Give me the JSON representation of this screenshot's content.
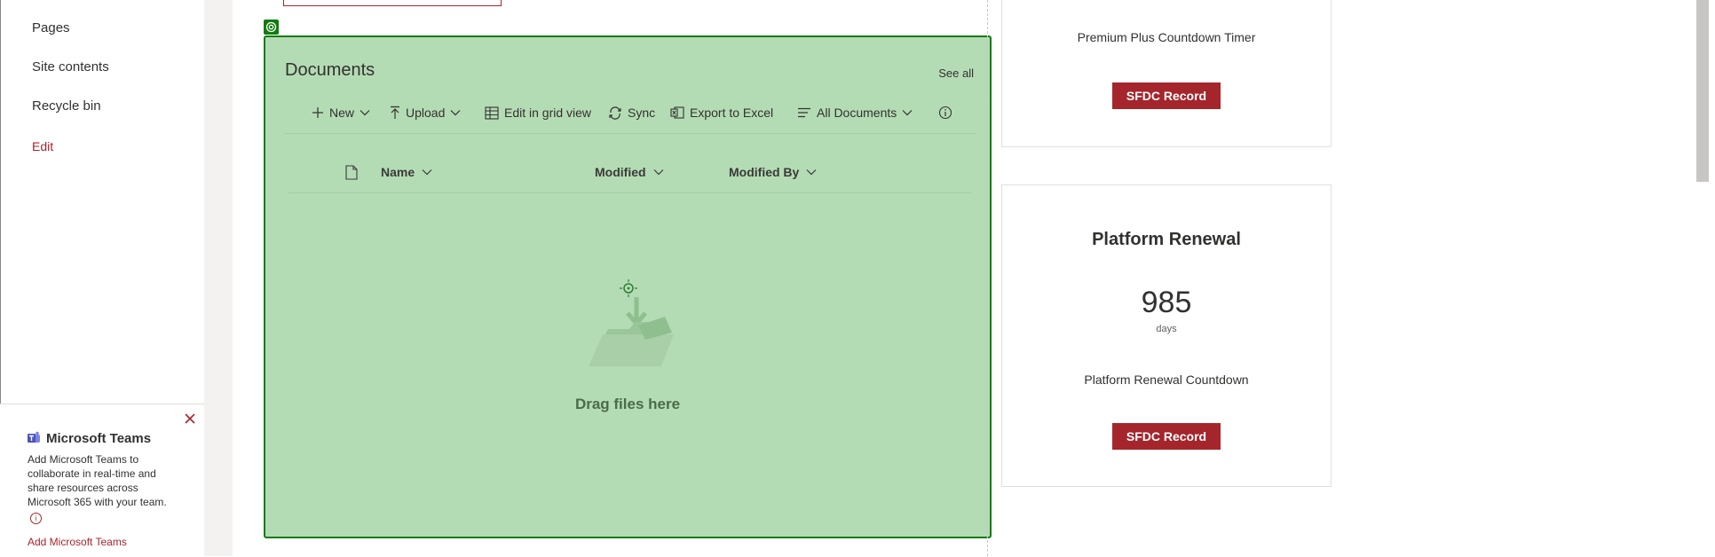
{
  "nav": {
    "items": [
      {
        "label": "Pages"
      },
      {
        "label": "Site contents"
      },
      {
        "label": "Recycle bin"
      }
    ],
    "edit_label": "Edit"
  },
  "teams_panel": {
    "title": "Microsoft Teams",
    "description": "Add Microsoft Teams to collaborate in real-time and share resources across Microsoft 365 with your team.",
    "link": "Add Microsoft Teams"
  },
  "documents": {
    "title": "Documents",
    "see_all": "See all",
    "commands": {
      "new": "New",
      "upload": "Upload",
      "edit_grid": "Edit in grid view",
      "sync": "Sync",
      "export": "Export to Excel",
      "view": "All Documents"
    },
    "columns": [
      "Name",
      "Modified",
      "Modified By"
    ],
    "empty_text": "Drag files here"
  },
  "cards": [
    {
      "subtitle": "Premium Plus Countdown Timer",
      "button": "SFDC Record"
    },
    {
      "title": "Platform Renewal",
      "value": "985",
      "unit": "days",
      "subtitle": "Platform Renewal Countdown",
      "button": "SFDC Record"
    }
  ],
  "colors": {
    "accent": "#a4262c",
    "drop_zone": "#b4dcb4",
    "drop_border": "#107c10"
  }
}
